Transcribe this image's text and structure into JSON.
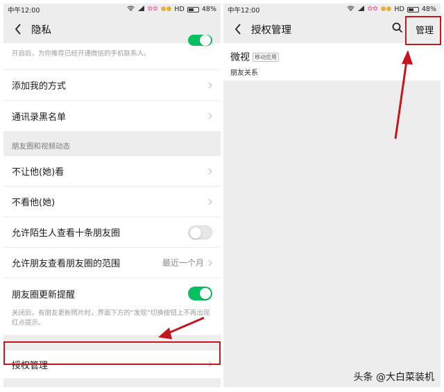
{
  "left": {
    "status": {
      "time": "中午12:00",
      "network": "HD",
      "battery": "48%"
    },
    "nav": {
      "title": "隐私"
    },
    "top_hint": "开启后，为你推荐已经开通微信的手机联系人。",
    "rows_a": [
      {
        "label": "添加我的方式"
      },
      {
        "label": "通讯录黑名单"
      }
    ],
    "group_title": "朋友圈和视频动态",
    "rows_b": [
      {
        "label": "不让他(她)看"
      },
      {
        "label": "不看他(她)"
      },
      {
        "label": "允许陌生人查看十条朋友圈",
        "toggle": "off"
      },
      {
        "label": "允许朋友查看朋友圈的范围",
        "value": "最近一个月"
      },
      {
        "label": "朋友圈更新提醒",
        "toggle": "on"
      }
    ],
    "update_hint": "关闭后，有朋友更新照片时，界面下方的“发现”切换按钮上不再出现红点提示。",
    "auth_row": {
      "label": "授权管理"
    }
  },
  "right": {
    "status": {
      "time": "中午12:00",
      "network": "HD",
      "battery": "48%"
    },
    "nav": {
      "title": "授权管理",
      "manage": "管理"
    },
    "app": {
      "name": "微视",
      "tag": "移动应用",
      "permission": "朋友关系"
    }
  },
  "watermark": "头条 @大白菜装机",
  "colors": {
    "accent_green": "#07c160",
    "highlight_red": "#c5161d",
    "background": "#ededed"
  },
  "icons": [
    "back-icon",
    "chevron-right-icon",
    "search-icon",
    "wifi-icon",
    "signal-icon",
    "battery-icon"
  ]
}
